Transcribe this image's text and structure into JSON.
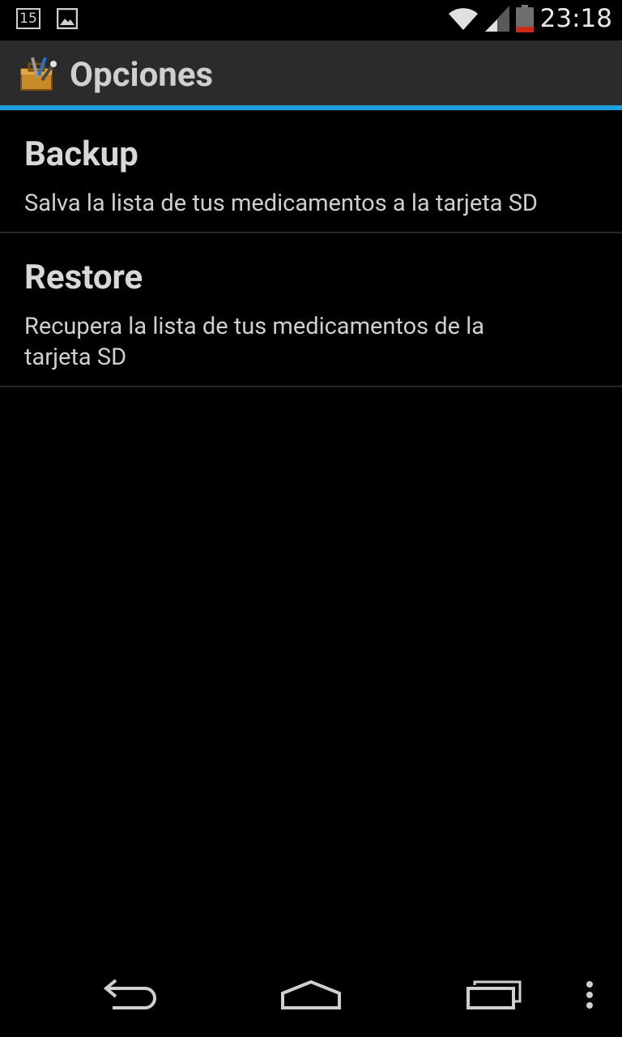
{
  "status_bar": {
    "notification_badge": "15",
    "notification_icons": [
      "calendar-icon",
      "image-icon"
    ],
    "system_icons": [
      "wifi-icon",
      "cell-signal-icon",
      "battery-icon"
    ],
    "time": "23:18"
  },
  "action_bar": {
    "app_icon": "toolbox-icon",
    "title": "Opciones",
    "accent_color": "#1a9ee0",
    "background_color": "#2b2b2b"
  },
  "preferences": [
    {
      "title": "Backup",
      "summary": "Salva la lista de tus medicamentos a la tarjeta SD"
    },
    {
      "title": "Restore",
      "summary": "Recupera la lista de tus medicamentos de la tarjeta SD"
    }
  ],
  "nav_bar": {
    "buttons": [
      "back-icon",
      "home-icon",
      "recent-apps-icon",
      "overflow-menu-icon"
    ]
  }
}
